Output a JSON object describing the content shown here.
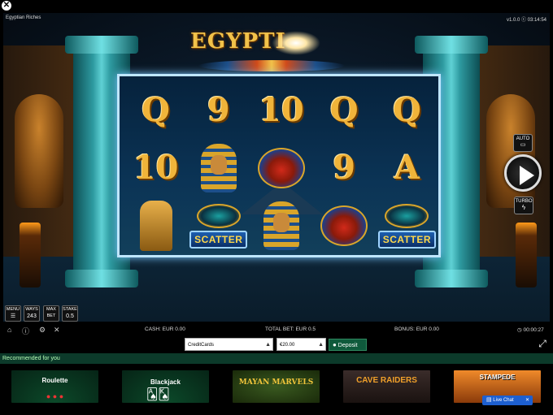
{
  "window": {
    "close_icon": "✕"
  },
  "game": {
    "title": "Egyptian Riches",
    "version_clock": "v1.0.0 ⓒ 03:14:54",
    "logo_text": "EGYPTI",
    "reels": [
      [
        {
          "type": "card",
          "text": "Q"
        },
        {
          "type": "card",
          "text": "9"
        },
        {
          "type": "card",
          "text": "10"
        },
        {
          "type": "card",
          "text": "Q"
        },
        {
          "type": "card",
          "text": "Q"
        }
      ],
      [
        {
          "type": "card",
          "text": "10"
        },
        {
          "type": "pharaoh"
        },
        {
          "type": "scarab"
        },
        {
          "type": "card",
          "text": "9"
        },
        {
          "type": "card",
          "text": "A"
        }
      ],
      [
        {
          "type": "sphinx"
        },
        {
          "type": "scatter",
          "text": "SCATTER"
        },
        {
          "type": "pharaoh"
        },
        {
          "type": "scarab"
        },
        {
          "type": "scatter",
          "text": "SCATTER"
        }
      ]
    ]
  },
  "controls": {
    "auto_label": "AUTO",
    "turbo_label": "TURBO",
    "menu_label": "MENU",
    "ways_label": "WAYS",
    "ways_value": "243",
    "max_label": "MAX",
    "bet_label": "BET",
    "stake_label": "STAKE",
    "stake_value": "0.5"
  },
  "status": {
    "cash": "CASH: EUR 0.00",
    "total_bet": "TOTAL BET: EUR 0.5",
    "bonus": "BONUS: EUR 0.00",
    "session_time": "00:00:27"
  },
  "deposit": {
    "method": "CreditCards",
    "amount": "€20.00",
    "button_label": "Deposit"
  },
  "recommended": {
    "header": "Recommended for you",
    "tiles": [
      "Roulette",
      "Blackjack",
      "MAYAN MARVELS",
      "CAVE RAIDERS",
      "STAMPEDE"
    ],
    "chat_label": "Live Chat"
  },
  "colors": {
    "accent_gold": "#f0b43a",
    "reel_border": "#bfe6ff",
    "rec_header_bg": "#0c3a2a",
    "deposit_green": "#0f5a3c"
  }
}
